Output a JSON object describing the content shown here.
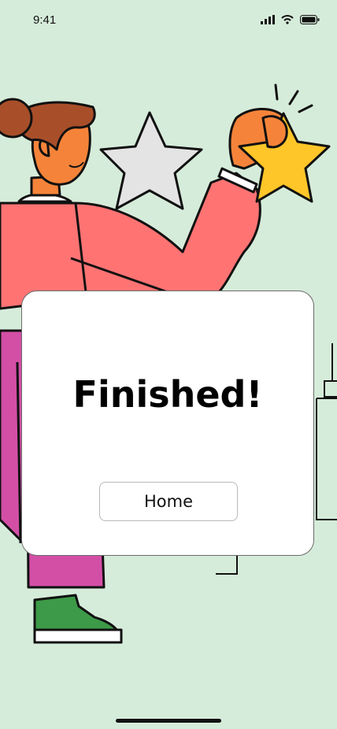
{
  "status_bar": {
    "time": "9:41"
  },
  "dialog": {
    "title": "Finished!",
    "home_button_label": "Home"
  },
  "icons": [
    "signal-icon",
    "wifi-icon",
    "battery-icon"
  ]
}
